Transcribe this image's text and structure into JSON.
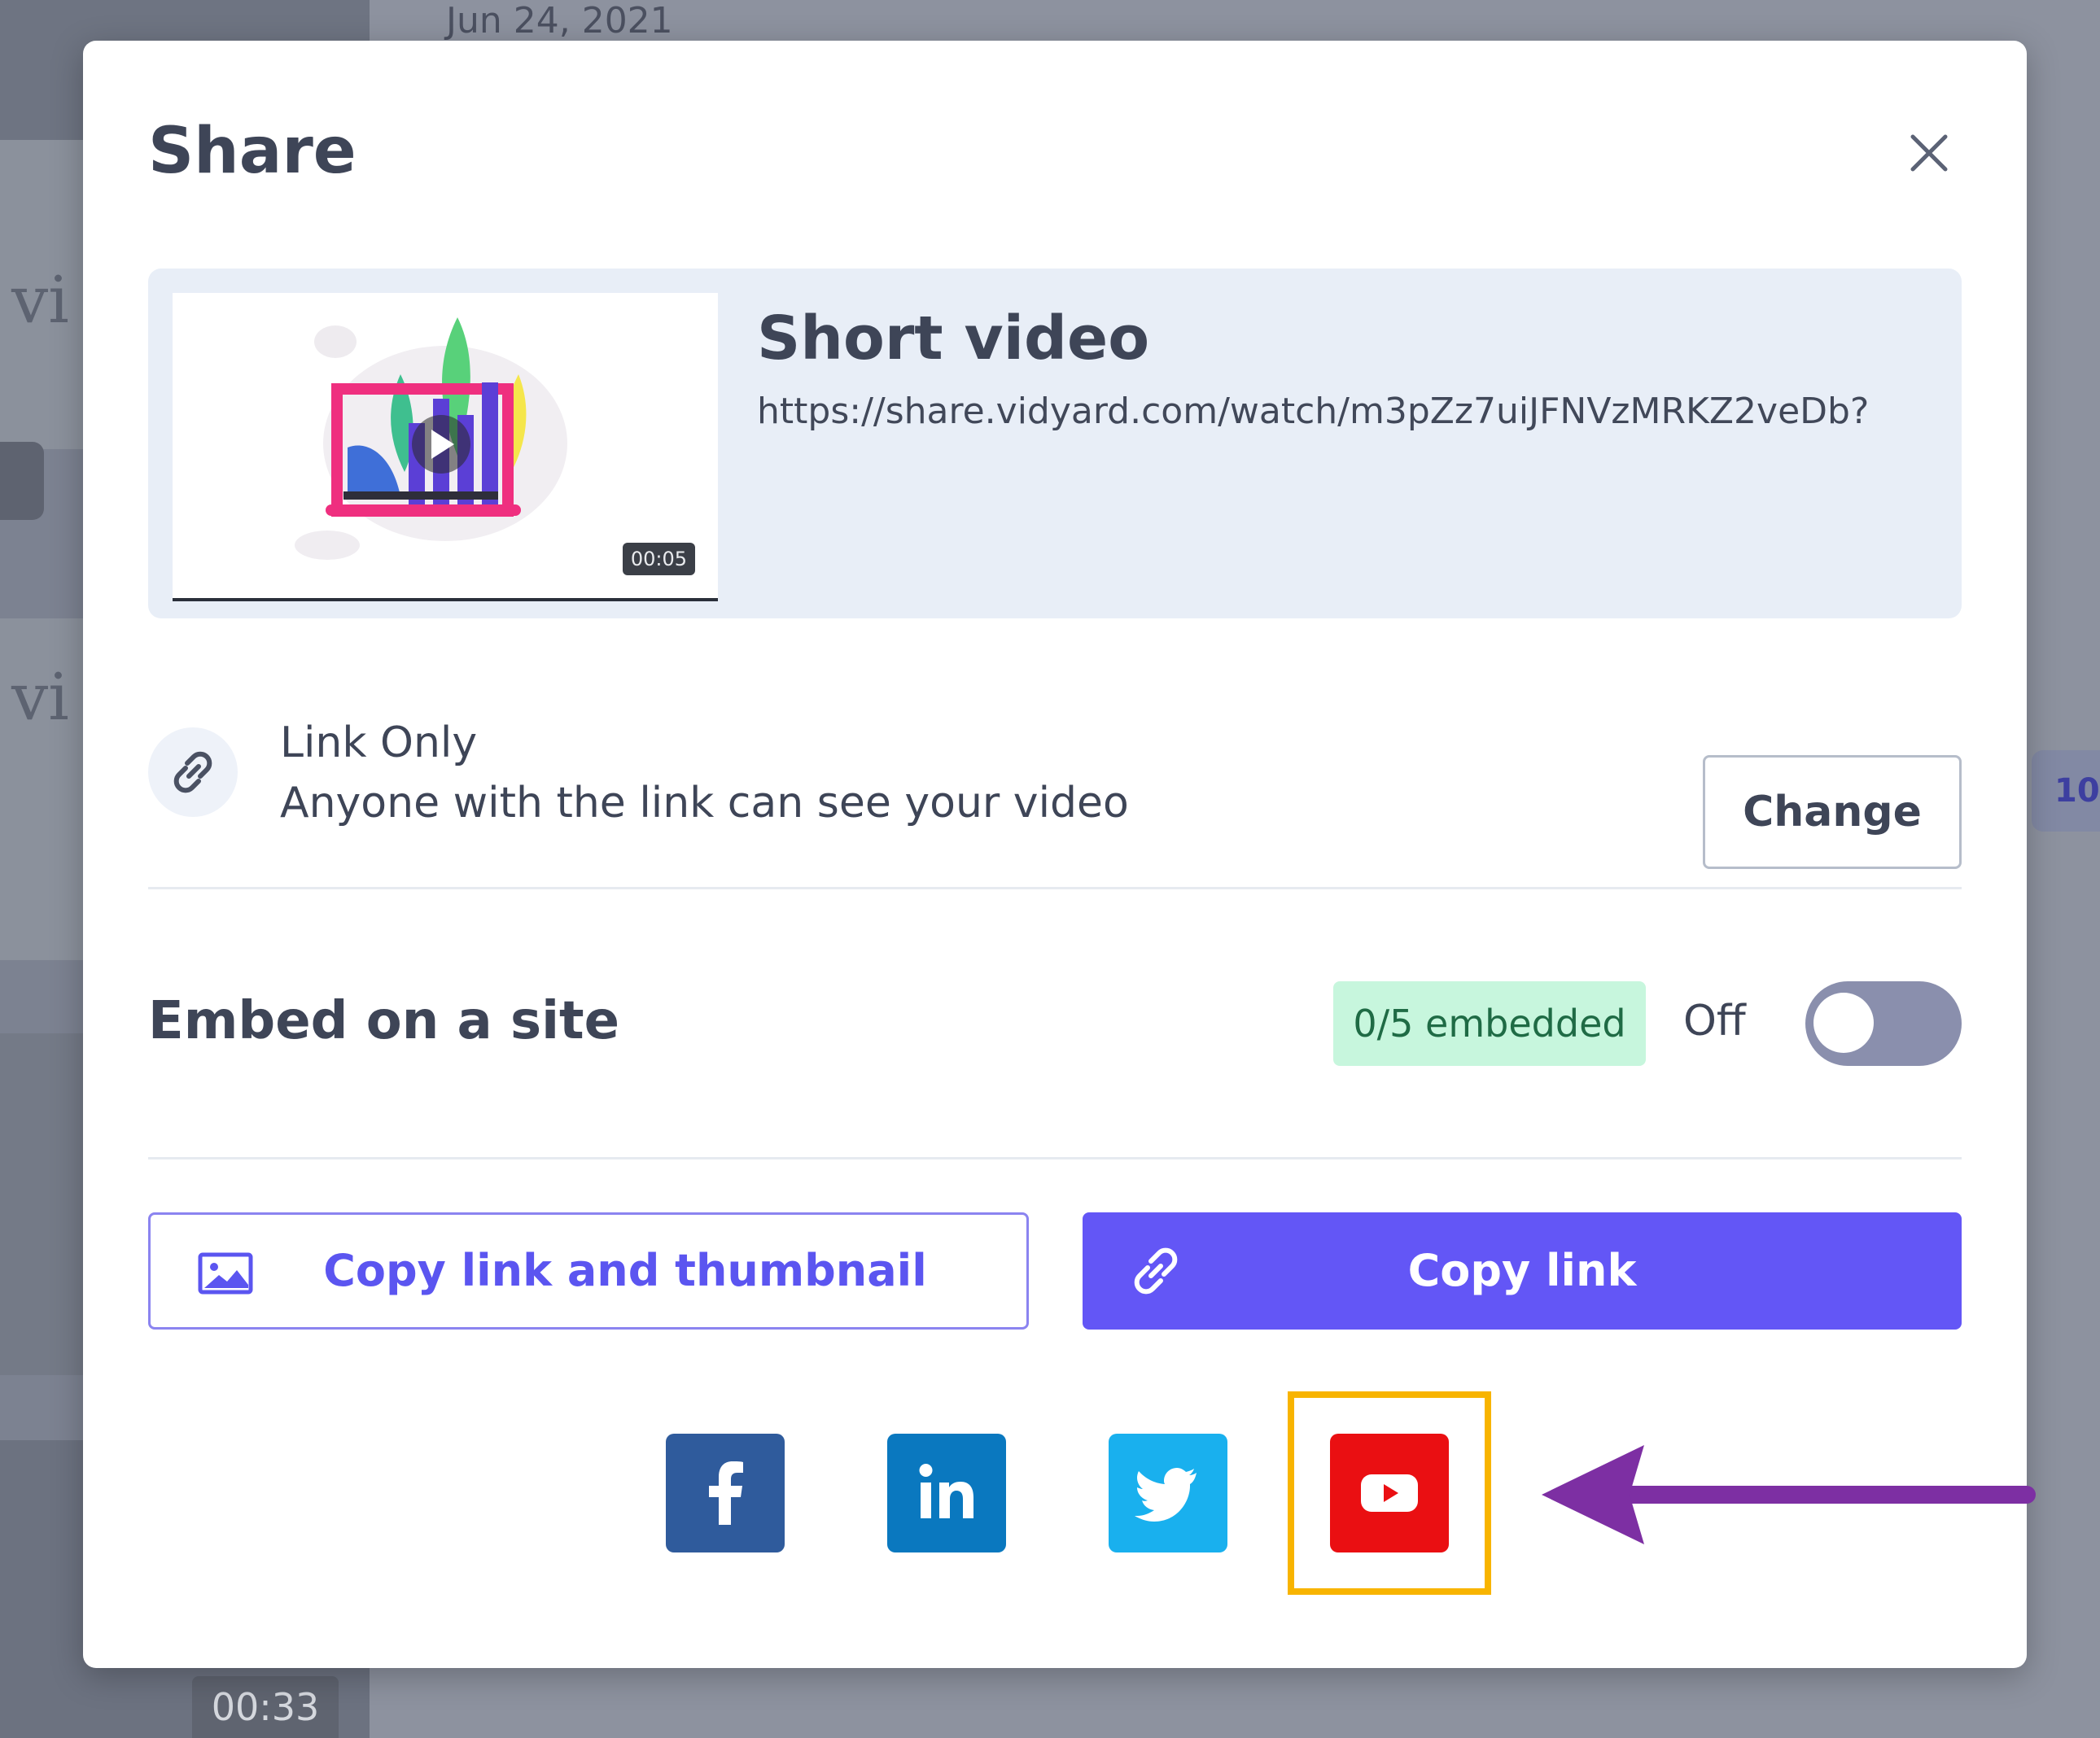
{
  "background": {
    "date": "Jun 24, 2021",
    "logo_text": "vi",
    "duration": "00:33",
    "chip_text": "10"
  },
  "modal": {
    "title": "Share",
    "close_icon": "close-icon"
  },
  "video": {
    "title": "Short video",
    "url": "https://share.vidyard.com/watch/m3pZz7uiJFNVzMRKZ2veDb?",
    "duration": "00:05"
  },
  "privacy": {
    "icon": "link-icon",
    "title": "Link Only",
    "description": "Anyone with the link can see your video",
    "change_label": "Change"
  },
  "embed": {
    "title": "Embed on a site",
    "badge": "0/5 embedded",
    "toggle_label": "Off",
    "toggle_on": false
  },
  "actions": {
    "copy_thumbnail_label": "Copy link and thumbnail",
    "copy_link_label": "Copy link"
  },
  "social": {
    "items": [
      "facebook",
      "linkedin",
      "twitter",
      "youtube"
    ],
    "highlighted": "youtube"
  },
  "colors": {
    "accent": "#6356f6",
    "facebook": "#2f5b9c",
    "linkedin": "#0a78bf",
    "twitter": "#19b0ee",
    "youtube": "#ea0f12",
    "highlight": "#f8b400",
    "arrow": "#7d2fa3"
  }
}
